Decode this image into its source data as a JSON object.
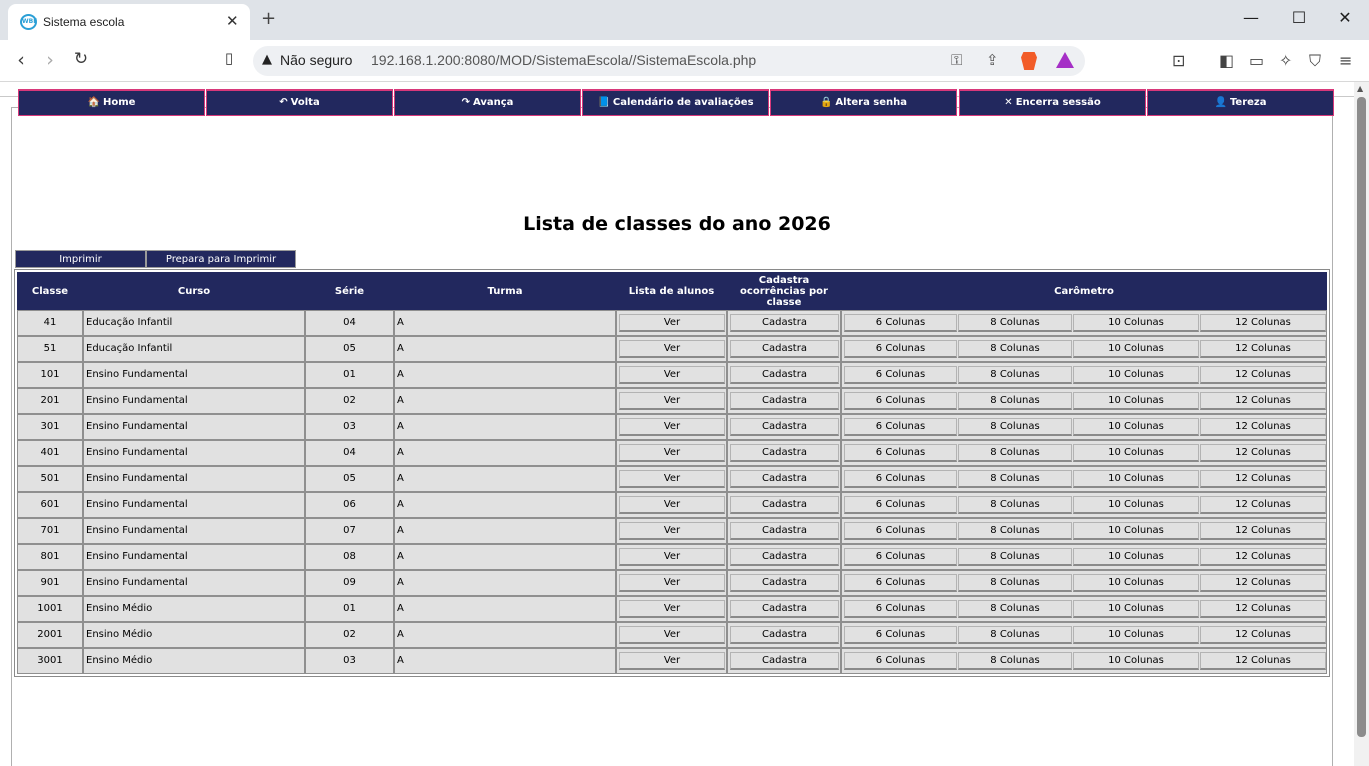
{
  "browser": {
    "tab_title": "Sistema escola",
    "tab_close": "✕",
    "new_tab": "+",
    "insecure_label": "Não seguro",
    "url": "192.168.1.200:8080/MOD/SistemaEscola//SistemaEscola.php",
    "window_controls": {
      "minimize": "—",
      "maximize": "☐",
      "close": "✕"
    }
  },
  "menu": [
    {
      "icon": "🏠",
      "label": "Home"
    },
    {
      "icon": "↶",
      "label": "Volta"
    },
    {
      "icon": "↷",
      "label": "Avança"
    },
    {
      "icon": "📘",
      "label": "Calendário de avaliações"
    },
    {
      "icon": "🔒",
      "label": "Altera senha"
    },
    {
      "icon": "✕",
      "label": "Encerra sessão"
    },
    {
      "icon": "👤",
      "label": "Tereza"
    }
  ],
  "page": {
    "title": "Lista de classes do ano 2026",
    "print_button": "Imprimir",
    "prepare_print_button": "Prepara para Imprimir"
  },
  "table": {
    "headers": {
      "classe": "Classe",
      "curso": "Curso",
      "serie": "Série",
      "turma": "Turma",
      "lista": "Lista de alunos",
      "cadastra": "Cadastra ocorrências por classe",
      "carometro": "Carômetro"
    },
    "button_labels": {
      "ver": "Ver",
      "cadastra": "Cadastra",
      "col6": "6 Colunas",
      "col8": "8 Colunas",
      "col10": "10 Colunas",
      "col12": "12 Colunas"
    },
    "rows": [
      {
        "classe": "41",
        "curso": "Educação Infantil",
        "serie": "04",
        "turma": "A"
      },
      {
        "classe": "51",
        "curso": "Educação Infantil",
        "serie": "05",
        "turma": "A"
      },
      {
        "classe": "101",
        "curso": "Ensino Fundamental",
        "serie": "01",
        "turma": "A"
      },
      {
        "classe": "201",
        "curso": "Ensino Fundamental",
        "serie": "02",
        "turma": "A"
      },
      {
        "classe": "301",
        "curso": "Ensino Fundamental",
        "serie": "03",
        "turma": "A"
      },
      {
        "classe": "401",
        "curso": "Ensino Fundamental",
        "serie": "04",
        "turma": "A"
      },
      {
        "classe": "501",
        "curso": "Ensino Fundamental",
        "serie": "05",
        "turma": "A"
      },
      {
        "classe": "601",
        "curso": "Ensino Fundamental",
        "serie": "06",
        "turma": "A"
      },
      {
        "classe": "701",
        "curso": "Ensino Fundamental",
        "serie": "07",
        "turma": "A"
      },
      {
        "classe": "801",
        "curso": "Ensino Fundamental",
        "serie": "08",
        "turma": "A"
      },
      {
        "classe": "901",
        "curso": "Ensino Fundamental",
        "serie": "09",
        "turma": "A"
      },
      {
        "classe": "1001",
        "curso": "Ensino Médio",
        "serie": "01",
        "turma": "A"
      },
      {
        "classe": "2001",
        "curso": "Ensino Médio",
        "serie": "02",
        "turma": "A"
      },
      {
        "classe": "3001",
        "curso": "Ensino Médio",
        "serie": "03",
        "turma": "A"
      }
    ]
  },
  "colors": {
    "menu_bg": "#22285e",
    "menu_border": "#d8387a",
    "cell_bg": "#e1e1e1"
  }
}
